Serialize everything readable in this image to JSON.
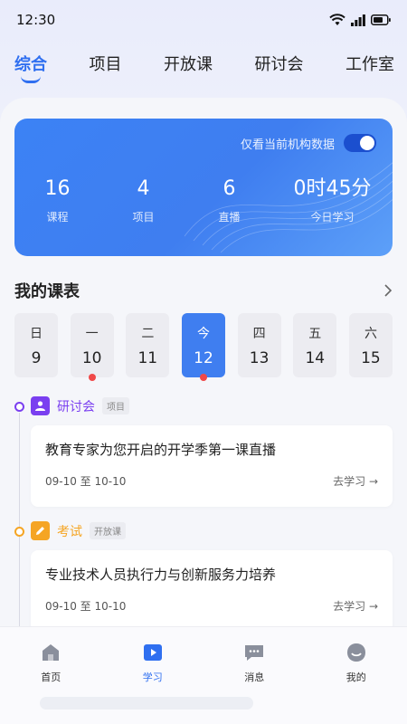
{
  "status": {
    "time": "12:30"
  },
  "tabs": [
    {
      "label": "综合",
      "active": true
    },
    {
      "label": "项目"
    },
    {
      "label": "开放课"
    },
    {
      "label": "研讨会"
    },
    {
      "label": "工作室"
    }
  ],
  "stats_card": {
    "toggle_label": "仅看当前机构数据",
    "toggle_on": true,
    "stats": [
      {
        "value": "16",
        "label": "课程"
      },
      {
        "value": "4",
        "label": "项目"
      },
      {
        "value": "6",
        "label": "直播"
      },
      {
        "value": "0时45分",
        "label": "今日学习"
      }
    ]
  },
  "schedule": {
    "title": "我的课表",
    "days": [
      {
        "weekday": "日",
        "date": "9"
      },
      {
        "weekday": "一",
        "date": "10",
        "dot": true
      },
      {
        "weekday": "二",
        "date": "11"
      },
      {
        "weekday": "今",
        "date": "12",
        "dot": true,
        "active": true
      },
      {
        "weekday": "四",
        "date": "13"
      },
      {
        "weekday": "五",
        "date": "14"
      },
      {
        "weekday": "六",
        "date": "15"
      }
    ]
  },
  "timeline": [
    {
      "type": "研讨会",
      "tag": "项目",
      "color": "#7a3ff0",
      "course_title": "教育专家为您开启的开学季第一课直播",
      "date_range": "09-10 至 10-10",
      "action": "去学习 →"
    },
    {
      "type": "考试",
      "tag": "开放课",
      "color": "#f5a524",
      "course_title": "专业技术人员执行力与创新服务力培养",
      "date_range": "09-10 至 10-10",
      "action": "去学习 →"
    }
  ],
  "bottom_nav": [
    {
      "label": "首页",
      "icon": "home-icon"
    },
    {
      "label": "学习",
      "icon": "play-icon",
      "active": true
    },
    {
      "label": "消息",
      "icon": "message-icon"
    },
    {
      "label": "我的",
      "icon": "profile-icon"
    }
  ],
  "colors": {
    "accent": "#2f6ff0",
    "dot": "#f04848"
  }
}
